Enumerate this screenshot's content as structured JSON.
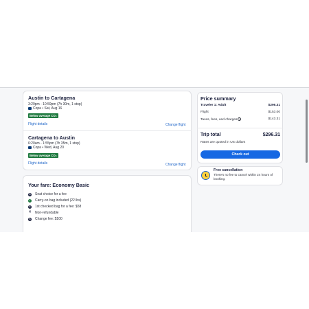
{
  "flights": [
    {
      "title": "Austin to Cartagena",
      "times": "3:29pm - 10:59pm (7h 30m, 1 stop)",
      "airline_date": "Copa • Sat, Aug 16",
      "co2_badge": "Below average CO₂",
      "details_link": "Flight details",
      "change_link": "Change flight"
    },
    {
      "title": "Cartagena to Austin",
      "times": "6:20am - 1:55pm (7h 35m, 1 stop)",
      "airline_date": "Copa • Wed, Aug 20",
      "co2_badge": "Below average CO₂",
      "details_link": "Flight details",
      "change_link": "Change flight"
    }
  ],
  "fare": {
    "title": "Your fare: Economy Basic",
    "items": [
      {
        "text": "Seat choice for a fee",
        "icon": "dollar-icon"
      },
      {
        "text": "Carry-on bag included (22 lbs)",
        "icon": "check-icon"
      },
      {
        "text": "1st checked bag for a fee: $58",
        "icon": "dollar-icon"
      },
      {
        "text": "Non-refundable",
        "icon": "x-icon"
      },
      {
        "text": "Change fee: $100",
        "icon": "dollar-icon"
      }
    ]
  },
  "price_summary": {
    "title": "Price summary",
    "traveler_label": "Traveler 1: Adult",
    "traveler_total": "$296.31",
    "flight_label": "Flight",
    "flight_value": "$153.00",
    "taxes_label": "Taxes, fees, and charges",
    "taxes_value": "$143.31",
    "trip_total_label": "Trip total",
    "trip_total_value": "$296.31",
    "currency_note": "Rates are quoted in US dollars",
    "checkout_label": "Check out"
  },
  "cancellation": {
    "title": "Free cancellation",
    "text": "There's no fee to cancel within 24 hours of booking."
  }
}
